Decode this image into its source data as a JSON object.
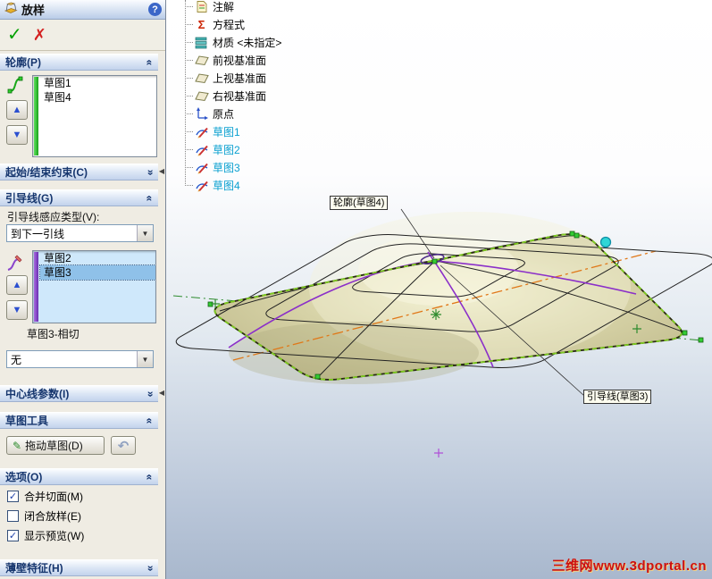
{
  "panel": {
    "title": "放样",
    "profiles": {
      "header": "轮廓(P)",
      "items": [
        "草图1",
        "草图4"
      ]
    },
    "start_end": {
      "header": "起始/结束约束(C)"
    },
    "guides": {
      "header": "引导线(G)",
      "influence_label": "引导线感应类型(V):",
      "influence_value": "到下一引线",
      "items": [
        "草图2",
        "草图3"
      ],
      "tangency_label": "草图3-相切",
      "tangency_value": "无"
    },
    "centerline": {
      "header": "中心线参数(I)"
    },
    "sketch_tools": {
      "header": "草图工具",
      "drag_button": "拖动草图(D)"
    },
    "options": {
      "header": "选项(O)",
      "items": [
        {
          "label": "合并切面(M)",
          "mark": "✓"
        },
        {
          "label": "闭合放样(E)",
          "mark": ""
        },
        {
          "label": "显示预览(W)",
          "mark": "✓"
        }
      ]
    },
    "thin": {
      "header": "薄壁特征(H)"
    }
  },
  "tree": {
    "items": [
      {
        "label": "注解"
      },
      {
        "label": "方程式"
      },
      {
        "label": "材质 <未指定>"
      },
      {
        "label": "前视基准面"
      },
      {
        "label": "上视基准面"
      },
      {
        "label": "右视基准面"
      },
      {
        "label": "原点"
      },
      {
        "label": "草图1"
      },
      {
        "label": "草图2"
      },
      {
        "label": "草图3"
      },
      {
        "label": "草图4"
      }
    ]
  },
  "viewport": {
    "callout_profile": "轮廓(草图4)",
    "callout_guide": "引导线(草图3)",
    "watermark": "三维网www.3dportal.cn"
  },
  "icons": {
    "help": "?",
    "ok": "✓",
    "cancel": "✗",
    "up": "▲",
    "down": "▼",
    "dropdown_arrow": "▼",
    "undo": "↶",
    "sigma": "Σ",
    "chevron": "«",
    "flyout": "◀",
    "drag_pencil": "✎"
  },
  "colors": {
    "selection_blue": "#8fc1e9",
    "guide_purple": "#8b2fc9",
    "outline_green": "#7ecb1f",
    "centerline_orange": "#e07818",
    "sketch_text_blue": "#0aa0d0",
    "watermark_red": "#cc1111",
    "surface_khaki": "#d3cfa2"
  }
}
